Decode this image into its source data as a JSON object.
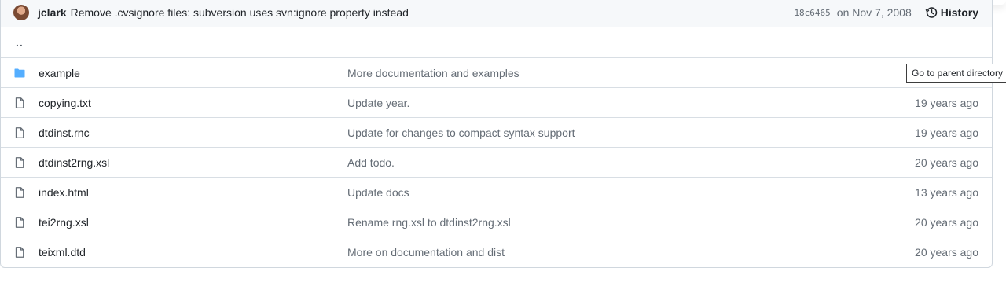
{
  "commit": {
    "author": "jclark",
    "message": "Remove .cvsignore files: subversion uses svn:ignore property instead",
    "sha": "18c6465",
    "date": "on Nov 7, 2008",
    "history_label": "History"
  },
  "parent_dir": {
    "label": ".."
  },
  "tooltip": {
    "text": "Go to parent directory"
  },
  "colors": {
    "folder": "#54aeff",
    "file_icon": "#656d76",
    "border": "#d0d7de"
  },
  "files": [
    {
      "icon": "folder-icon",
      "name": "example",
      "message": "More documentation and examples",
      "date": ""
    },
    {
      "icon": "file-icon",
      "name": "copying.txt",
      "message": "Update year.",
      "date": "19 years ago"
    },
    {
      "icon": "file-icon",
      "name": "dtdinst.rnc",
      "message": "Update for changes to compact syntax support",
      "date": "19 years ago"
    },
    {
      "icon": "file-icon",
      "name": "dtdinst2rng.xsl",
      "message": "Add todo.",
      "date": "20 years ago"
    },
    {
      "icon": "file-icon",
      "name": "index.html",
      "message": "Update docs",
      "date": "13 years ago"
    },
    {
      "icon": "file-icon",
      "name": "tei2rng.xsl",
      "message": "Rename rng.xsl to dtdinst2rng.xsl",
      "date": "20 years ago"
    },
    {
      "icon": "file-icon",
      "name": "teixml.dtd",
      "message": "More on documentation and dist",
      "date": "20 years ago"
    }
  ]
}
